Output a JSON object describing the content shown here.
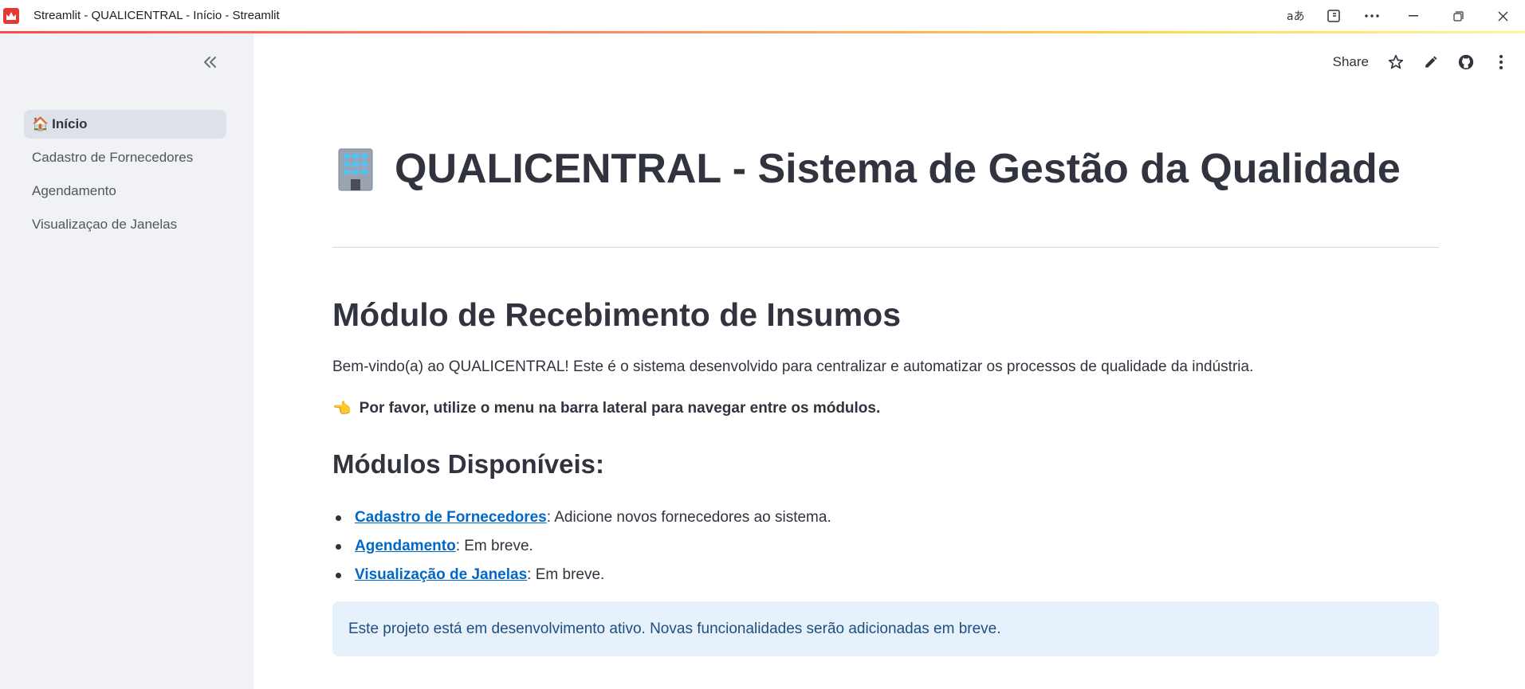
{
  "window": {
    "title": "Streamlit - QUALICENTRAL - Início - Streamlit"
  },
  "sidebar": {
    "items": [
      {
        "emoji": "🏠",
        "label": "Início",
        "active": true
      },
      {
        "label": "Cadastro de Fornecedores"
      },
      {
        "label": "Agendamento"
      },
      {
        "label": "Visualizaçao de Janelas"
      }
    ]
  },
  "toolbar": {
    "share_label": "Share"
  },
  "main": {
    "title": "QUALICENTRAL - Sistema de Gestão da Qualidade",
    "section_title": "Módulo de Recebimento de Insumos",
    "welcome_text": "Bem-vindo(a) ao QUALICENTRAL! Este é o sistema desenvolvido para centralizar e automatizar os processos de qualidade da indústria.",
    "hint_emoji": "👈",
    "hint_text": "Por favor, utilize o menu na barra lateral para navegar entre os módulos.",
    "modules_title": "Módulos Disponíveis:",
    "modules": [
      {
        "link": "Cadastro de Fornecedores",
        "desc": ": Adicione novos fornecedores ao sistema."
      },
      {
        "link": "Agendamento",
        "desc": ": Em breve."
      },
      {
        "link": "Visualização de Janelas",
        "desc": ": Em breve."
      }
    ],
    "info_text": "Este projeto está em desenvolvimento ativo. Novas funcionalidades serão adicionadas em breve."
  },
  "colors": {
    "accent": "#ff4b4b",
    "link": "#0068c9",
    "sidebar_bg": "#f0f2f6",
    "info_bg": "#e7f1fb"
  },
  "icons": [
    "streamlit-logo-icon",
    "translate-icon",
    "reader-mode-icon",
    "more-icon",
    "minimize-icon",
    "restore-icon",
    "close-icon",
    "collapse-sidebar-icon",
    "star-icon",
    "edit-icon",
    "github-icon",
    "kebab-menu-icon",
    "building-icon"
  ]
}
